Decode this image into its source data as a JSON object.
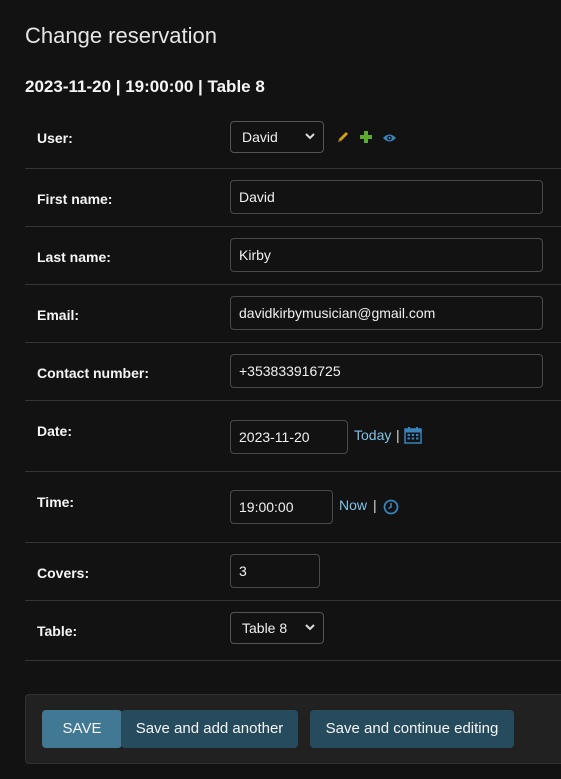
{
  "header": {
    "title": "Change reservation",
    "object_title": "2023-11-20 | 19:00:00 | Table 8"
  },
  "form": {
    "user": {
      "label": "User:",
      "value": "David"
    },
    "first_name": {
      "label": "First name:",
      "value": "David"
    },
    "last_name": {
      "label": "Last name:",
      "value": "Kirby"
    },
    "email": {
      "label": "Email:",
      "value": "davidkirbymusician@gmail.com"
    },
    "contact_number": {
      "label": "Contact number:",
      "value": "+353833916725"
    },
    "date": {
      "label": "Date:",
      "value": "2023-11-20",
      "shortcut": "Today",
      "separator": "|"
    },
    "time": {
      "label": "Time:",
      "value": "19:00:00",
      "shortcut": "Now",
      "separator": "|"
    },
    "covers": {
      "label": "Covers:",
      "value": "3"
    },
    "table": {
      "label": "Table:",
      "value": "Table 8"
    }
  },
  "actions": {
    "save": "SAVE",
    "save_add_another": "Save and add another",
    "save_continue": "Save and continue editing"
  },
  "icons": {
    "edit": "pencil-icon",
    "add": "plus-icon",
    "view": "eye-icon",
    "calendar": "calendar-icon",
    "clock": "clock-icon",
    "chevron": "chevron-down-icon"
  },
  "colors": {
    "background": "#121212",
    "link": "#7ec3e8",
    "save_button": "#417893",
    "secondary_button": "#264b5d",
    "edit_icon": "#d4a017",
    "add_icon": "#5dab2c",
    "view_icon": "#3a83b8"
  }
}
